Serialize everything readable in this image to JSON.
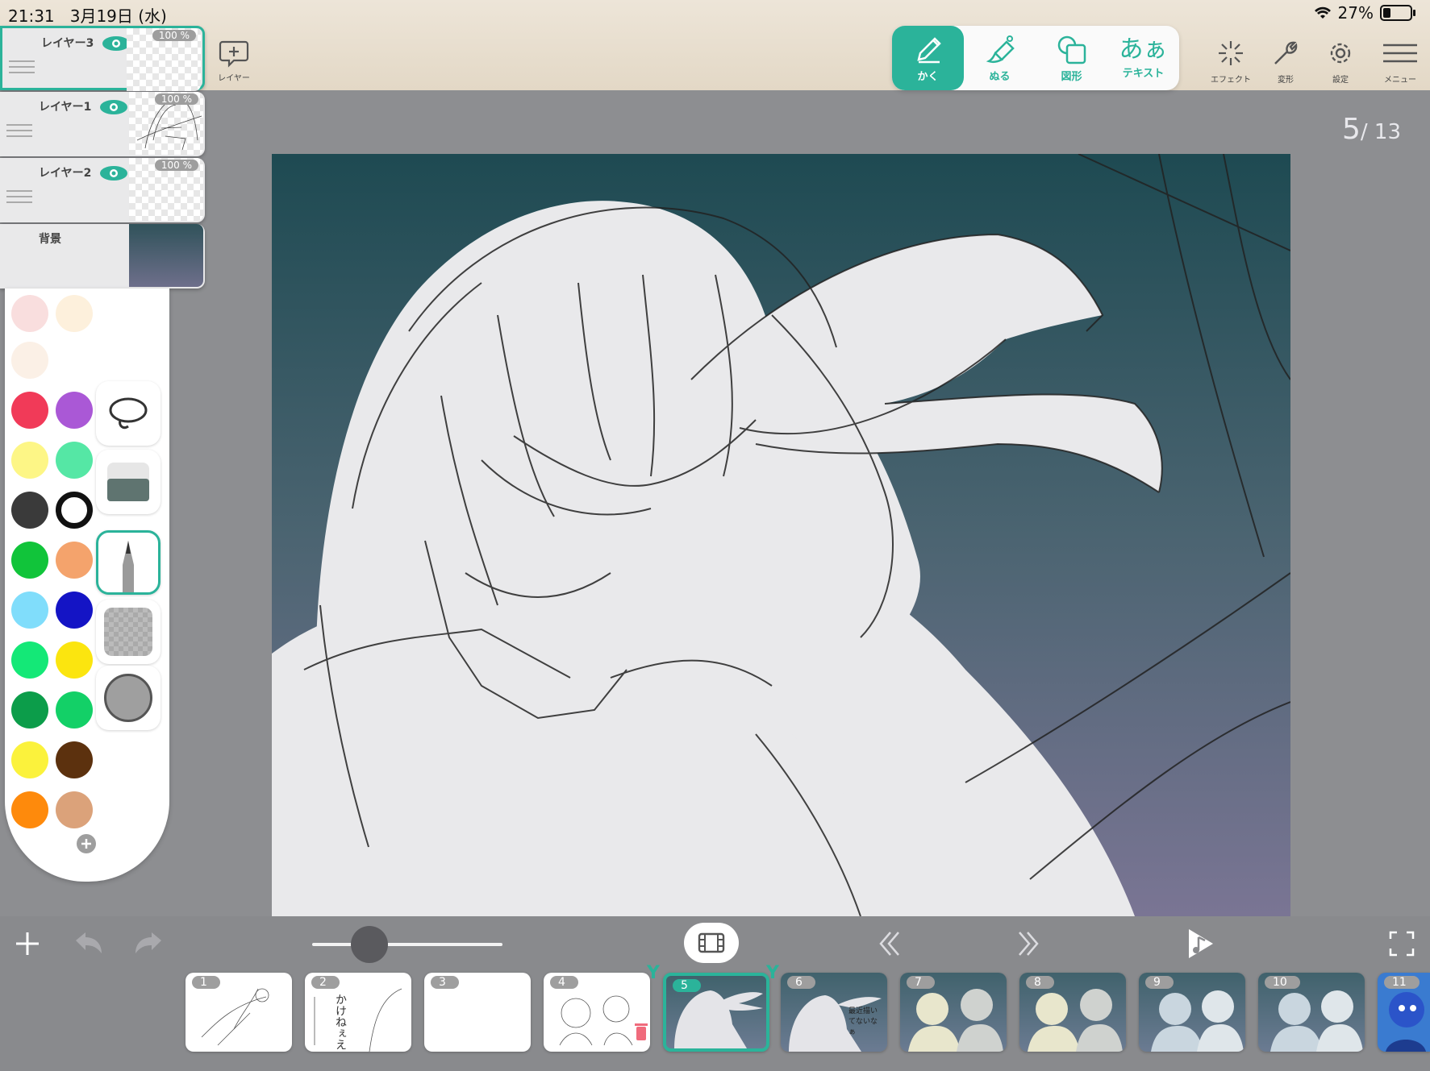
{
  "status": {
    "time": "21:31",
    "date": "3月19日 (水)",
    "battery": "27%"
  },
  "layers": [
    {
      "name": "レイヤー3",
      "opacity": "100 %"
    },
    {
      "name": "レイヤー1",
      "opacity": "100 %"
    },
    {
      "name": "レイヤー2",
      "opacity": "100 %"
    },
    {
      "name": "背景"
    }
  ],
  "layer_add_label": "レイヤー",
  "tools": [
    {
      "label": "かく",
      "icon": "pen-icon"
    },
    {
      "label": "ぬる",
      "icon": "fill-brush-icon"
    },
    {
      "label": "図形",
      "icon": "shape-icon"
    },
    {
      "label": "テキスト",
      "glyph": "あぁ",
      "icon": "text-icon"
    }
  ],
  "right_tools": [
    {
      "label": "エフェクト",
      "icon": "effect-sparkle-icon"
    },
    {
      "label": "変形",
      "icon": "wrench-icon"
    },
    {
      "label": "設定",
      "icon": "gear-icon"
    },
    {
      "label": "メニュー",
      "icon": "menu-icon"
    }
  ],
  "page": {
    "current": "5",
    "total": "/ 13"
  },
  "palette": {
    "colors": [
      "#f9dede",
      "#fdf0dc",
      "#fbf0e6",
      "#ffffff",
      "#f13a58",
      "#aa58d6",
      "#fdf686",
      "#55e7a5",
      "#3a3a3a",
      "#ffffff",
      "#11c43a",
      "#f4a36c",
      "#80ddfb",
      "#1414c5",
      "#14e877",
      "#fbe50f",
      "#0c9d4a",
      "#13d067",
      "#fbf23c",
      "#5c310e",
      "#fe8a0c",
      "#dba27a"
    ]
  },
  "brush_size_level": 0.3,
  "frames": [
    "1",
    "2",
    "3",
    "4",
    "5",
    "6",
    "7",
    "8",
    "9",
    "10",
    "11"
  ],
  "frame2_text": "かけねぇえ",
  "frame6_text": "最近描いてないなぁ",
  "accent_color": "#2bb39a"
}
